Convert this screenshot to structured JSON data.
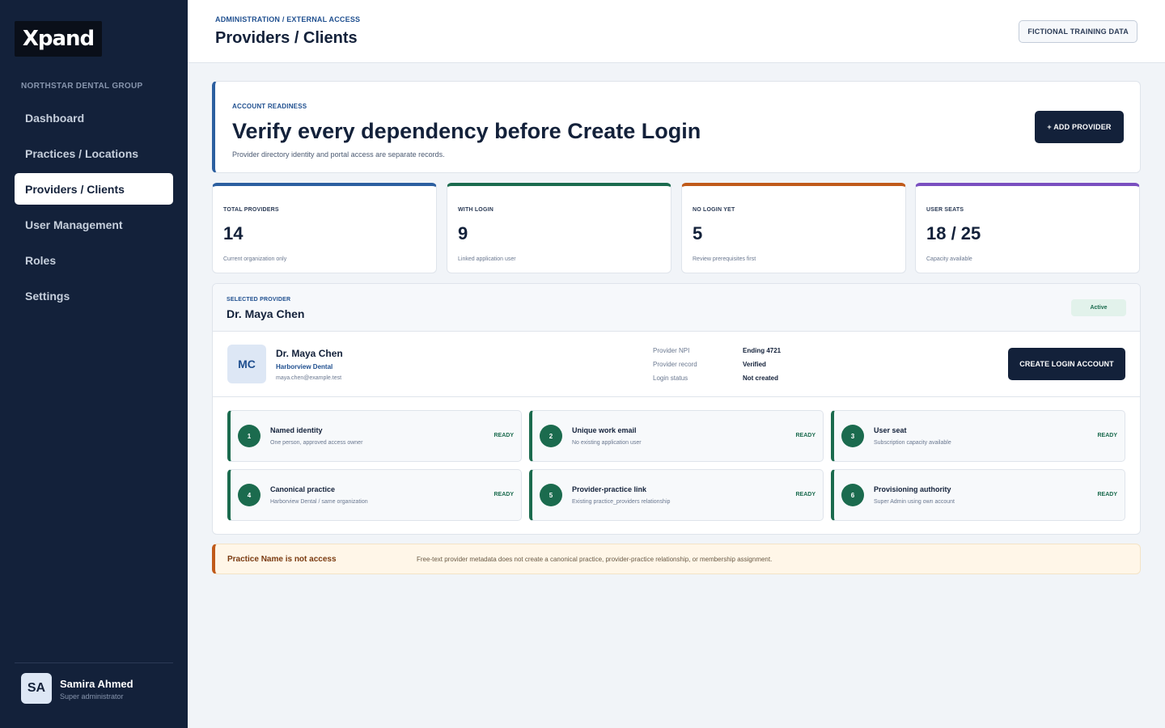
{
  "app": {
    "logo_text": "Xpand"
  },
  "sidebar": {
    "org_name": "NORTHSTAR DENTAL GROUP",
    "items": [
      {
        "label": "Dashboard"
      },
      {
        "label": "Practices / Locations"
      },
      {
        "label": "Providers / Clients",
        "active": true
      },
      {
        "label": "User Management"
      },
      {
        "label": "Roles"
      },
      {
        "label": "Settings"
      }
    ],
    "user": {
      "initials": "SA",
      "name": "Samira Ahmed",
      "role": "Super administrator"
    }
  },
  "header": {
    "breadcrumb": "ADMINISTRATION / EXTERNAL ACCESS",
    "title": "Providers / Clients",
    "badge": "FICTIONAL TRAINING DATA"
  },
  "hero": {
    "eyebrow": "ACCOUNT READINESS",
    "title": "Verify every dependency before Create Login",
    "subtitle": "Provider directory identity and portal access are separate records.",
    "button_label": "+ ADD PROVIDER"
  },
  "stats": [
    {
      "label": "TOTAL PROVIDERS",
      "value": "14",
      "note": "Current organization only",
      "color": "#2c5fa0"
    },
    {
      "label": "WITH LOGIN",
      "value": "9",
      "note": "Linked application user",
      "color": "#1b6b4e"
    },
    {
      "label": "NO LOGIN YET",
      "value": "5",
      "note": "Review prerequisites first",
      "color": "#c05a1a"
    },
    {
      "label": "USER SEATS",
      "value": "18 / 25",
      "note": "Capacity available",
      "color": "#7a4fc0"
    }
  ],
  "selected": {
    "eyebrow": "SELECTED PROVIDER",
    "name": "Dr. Maya Chen",
    "status": "Active",
    "initials": "MC",
    "provider_name": "Dr. Maya Chen",
    "practice": "Harborview Dental",
    "email": "maya.chen@example.test",
    "meta": [
      {
        "key": "Provider NPI",
        "value": "Ending 4721"
      },
      {
        "key": "Provider record",
        "value": "Verified"
      },
      {
        "key": "Login status",
        "value": "Not created"
      }
    ],
    "button_label": "CREATE LOGIN ACCOUNT"
  },
  "checks": [
    {
      "num": "1",
      "title": "Named identity",
      "sub": "One person, approved access owner",
      "state": "READY"
    },
    {
      "num": "2",
      "title": "Unique work email",
      "sub": "No existing application user",
      "state": "READY"
    },
    {
      "num": "3",
      "title": "User seat",
      "sub": "Subscription capacity available",
      "state": "READY"
    },
    {
      "num": "4",
      "title": "Canonical practice",
      "sub": "Harborview Dental / same organization",
      "state": "READY"
    },
    {
      "num": "5",
      "title": "Provider-practice link",
      "sub": "Existing practice_providers relationship",
      "state": "READY"
    },
    {
      "num": "6",
      "title": "Provisioning authority",
      "sub": "Super Admin using own account",
      "state": "READY"
    }
  ],
  "warning": {
    "title": "Practice Name is not access",
    "text": "Free-text provider metadata does not create a canonical practice, provider-practice relationship, or membership assignment."
  }
}
